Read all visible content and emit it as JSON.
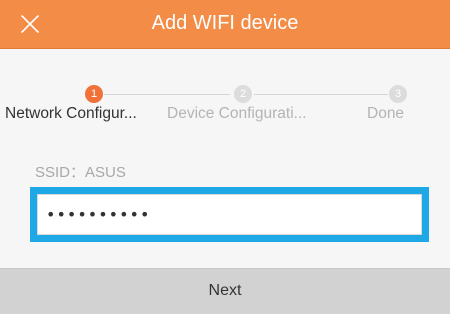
{
  "header": {
    "title": "Add WIFI device",
    "close_icon": "close-icon",
    "background_color": "#f28c46"
  },
  "stepper": {
    "active_color": "#f07238",
    "inactive_color": "#dcdcdc",
    "steps": [
      {
        "number": "1",
        "label": "Network Configur...",
        "state": "active"
      },
      {
        "number": "2",
        "label": "Device Configurati...",
        "state": "inactive"
      },
      {
        "number": "3",
        "label": "Done",
        "state": "inactive"
      }
    ]
  },
  "form": {
    "ssid_label": "SSID：ASUS",
    "password_value": "••••••••••",
    "highlight_color": "#1ea8e6"
  },
  "next_button": {
    "label": "Next"
  }
}
